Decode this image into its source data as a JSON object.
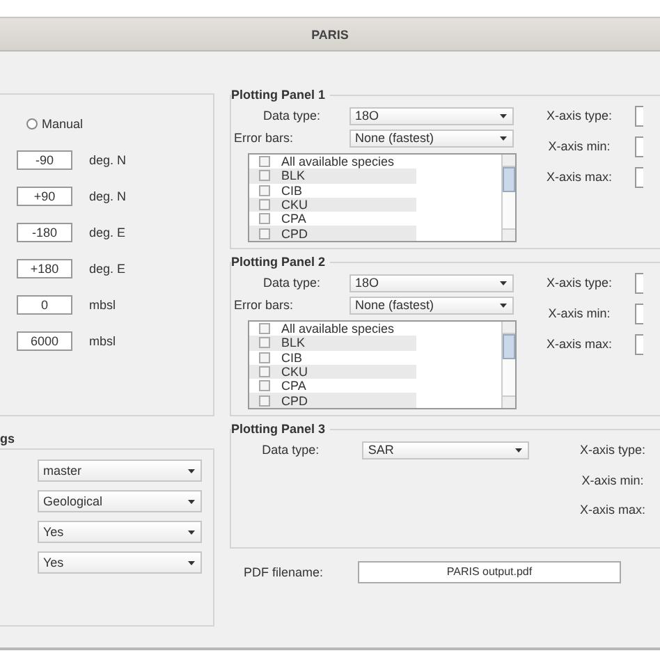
{
  "window": {
    "title": "PARIS"
  },
  "region_panel": {
    "radio": {
      "label": "Manual",
      "selected": false
    },
    "fields": [
      {
        "value": "-90",
        "unit": "deg. N"
      },
      {
        "value": "+90",
        "unit": "deg. N"
      },
      {
        "value": "-180",
        "unit": "deg. E"
      },
      {
        "value": "+180",
        "unit": "deg. E"
      },
      {
        "value": "0",
        "unit": "mbsl"
      },
      {
        "value": "6000",
        "unit": "mbsl"
      }
    ]
  },
  "settings_panel": {
    "title": "gs",
    "dropdowns": [
      "master",
      "Geological",
      "Yes",
      "Yes"
    ]
  },
  "plotting_panels": [
    {
      "title": "Plotting Panel 1",
      "data_type_label": "Data type:",
      "data_type": "18O",
      "error_bars_label": "Error bars:",
      "error_bars": "None (fastest)",
      "species": [
        {
          "label": "All available species",
          "checked": false
        },
        {
          "label": "BLK",
          "checked": false
        },
        {
          "label": "CIB",
          "checked": false
        },
        {
          "label": "CKU",
          "checked": false
        },
        {
          "label": "CPA",
          "checked": false
        },
        {
          "label": "CPD",
          "checked": false
        }
      ],
      "x_axis_type_label": "X-axis type:",
      "x_axis_min_label": "X-axis min:",
      "x_axis_max_label": "X-axis max:"
    },
    {
      "title": "Plotting Panel 2",
      "data_type_label": "Data type:",
      "data_type": "18O",
      "error_bars_label": "Error bars:",
      "error_bars": "None (fastest)",
      "species": [
        {
          "label": "All available species",
          "checked": false
        },
        {
          "label": "BLK",
          "checked": false
        },
        {
          "label": "CIB",
          "checked": false
        },
        {
          "label": "CKU",
          "checked": false
        },
        {
          "label": "CPA",
          "checked": false
        },
        {
          "label": "CPD",
          "checked": false
        }
      ],
      "x_axis_type_label": "X-axis type:",
      "x_axis_min_label": "X-axis min:",
      "x_axis_max_label": "X-axis max:"
    },
    {
      "title": "Plotting Panel 3",
      "data_type_label": "Data type:",
      "data_type": "SAR",
      "x_axis_type_label": "X-axis type:",
      "x_axis_min_label": "X-axis min:",
      "x_axis_max_label": "X-axis max:"
    }
  ],
  "pdf": {
    "label": "PDF filename:",
    "value": "PARIS output.pdf"
  }
}
